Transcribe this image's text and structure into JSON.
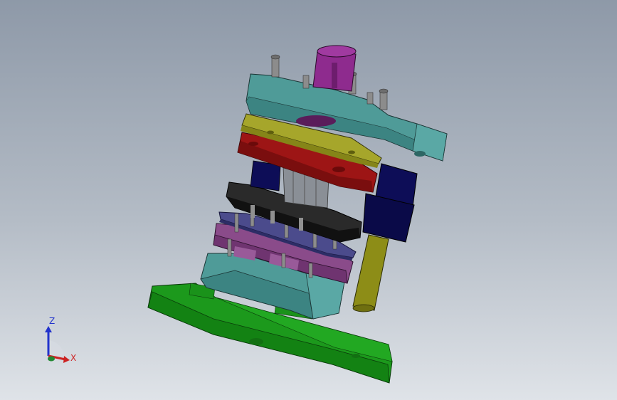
{
  "viewport": {
    "background_top": "#8e99a8",
    "background_bottom": "#dfe3e8"
  },
  "triad": {
    "z_label": "Z",
    "x_label": "X",
    "z_color": "#2233cc",
    "x_color": "#cc2222",
    "y_color": "#228833"
  },
  "model": {
    "parts": [
      {
        "name": "top-clamp-plate",
        "color": "#4e9a98"
      },
      {
        "name": "shank",
        "color": "#8e2a8e"
      },
      {
        "name": "backing-plate",
        "color": "#a5a52a"
      },
      {
        "name": "punch-holder",
        "color": "#9c1414"
      },
      {
        "name": "stripper-plate",
        "color": "#222222"
      },
      {
        "name": "guide-plate",
        "color": "#4a4a8a"
      },
      {
        "name": "die-plate",
        "color": "#8a4a8a"
      },
      {
        "name": "die-holder",
        "color": "#4e9a98"
      },
      {
        "name": "bottom-base-plate",
        "color": "#1a9a1a"
      },
      {
        "name": "guide-bushing",
        "color": "#0c0c55"
      },
      {
        "name": "guide-post",
        "color": "#8a8a14"
      }
    ]
  }
}
